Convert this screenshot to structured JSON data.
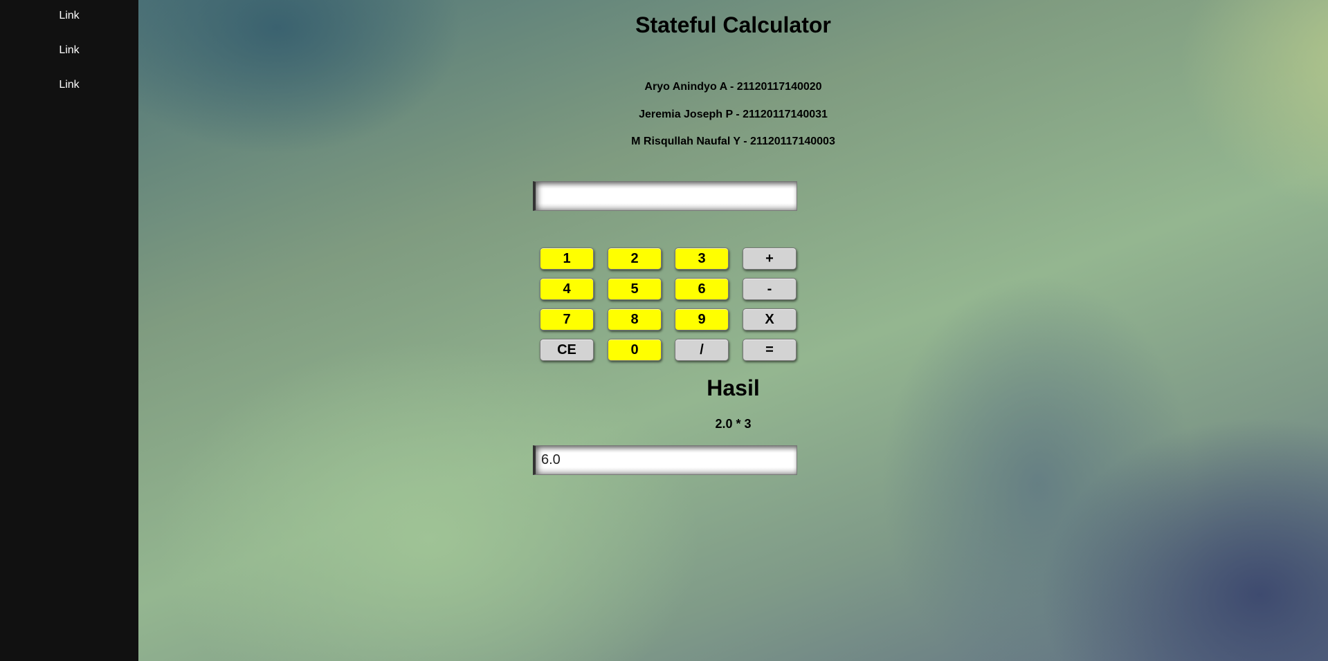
{
  "sidebar": {
    "links": [
      "Link",
      "Link",
      "Link"
    ]
  },
  "header": {
    "title": "Stateful Calculator"
  },
  "members": [
    "Aryo Anindyo A - 21120117140020",
    "Jeremia Joseph P - 21120117140031",
    "M Risqullah Naufal Y - 21120117140003"
  ],
  "calculator": {
    "input_value": "",
    "buttons": {
      "b1": "1",
      "b2": "2",
      "b3": "3",
      "plus": "+",
      "b4": "4",
      "b5": "5",
      "b6": "6",
      "minus": "-",
      "b7": "7",
      "b8": "8",
      "b9": "9",
      "times": "X",
      "ce": "CE",
      "b0": "0",
      "divide": "/",
      "equals": "="
    }
  },
  "result": {
    "heading": "Hasil",
    "expression": "2.0 * 3",
    "value": "6.0"
  },
  "colors": {
    "sidebar_bg": "#111111",
    "number_button": "#ffff00",
    "operator_button": "#d3d3d3"
  }
}
